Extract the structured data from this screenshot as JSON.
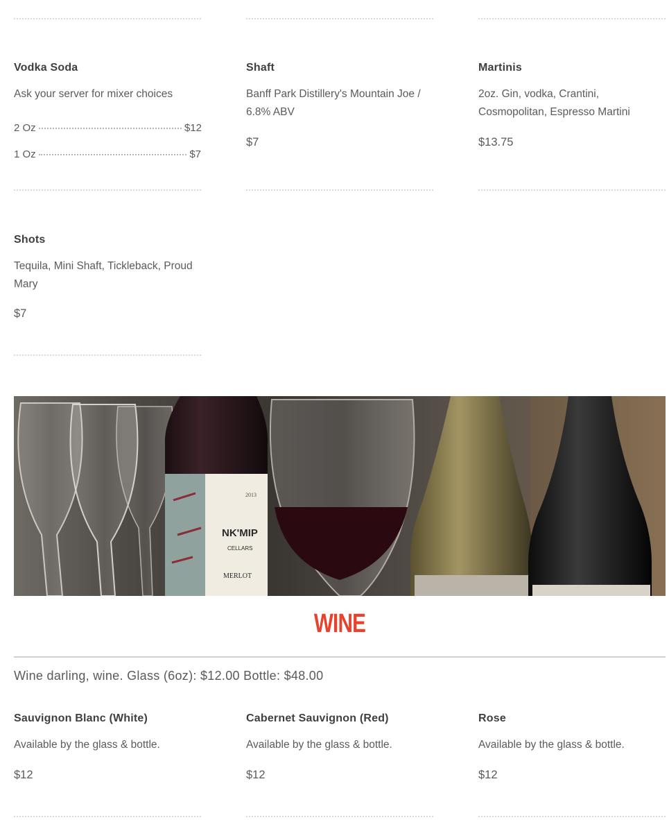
{
  "spirits": {
    "vodka_soda": {
      "title": "Vodka Soda",
      "description": "Ask your server for mixer choices",
      "sizes": [
        {
          "label": "2 Oz",
          "price": "$12"
        },
        {
          "label": "1 Oz",
          "price": "$7"
        }
      ]
    },
    "shaft": {
      "title": "Shaft",
      "description": "Banff Park Distillery's Mountain Joe / 6.8% ABV",
      "price": "$7"
    },
    "martinis": {
      "title": "Martinis",
      "description": "2oz. Gin, vodka, Crantini, Cosmopolitan, Espresso Martini",
      "price": "$13.75"
    },
    "shots": {
      "title": "Shots",
      "description": "Tequila, Mini Shaft, Tickleback, Proud Mary",
      "price": "$7"
    }
  },
  "wine_photo": {
    "label_brand": "NK'MIP",
    "label_sub": "CELLARS",
    "label_varietal": "MERLOT",
    "label_year": "2013"
  },
  "wine": {
    "title": "WINE",
    "intro": "Wine darling, wine. Glass (6oz): $12.00 Bottle: $48.00",
    "items": [
      {
        "title": "Sauvignon Blanc (White)",
        "description": "Available by the glass & bottle.",
        "price": "$12"
      },
      {
        "title": "Cabernet Sauvignon (Red)",
        "description": "Available by the glass & bottle.",
        "price": "$12"
      },
      {
        "title": "Rose",
        "description": "Available by the glass & bottle.",
        "price": "$12"
      }
    ]
  },
  "colors": {
    "accent": "#e8412c",
    "text": "#4a4a4a",
    "divider": "#d9d9d9"
  }
}
